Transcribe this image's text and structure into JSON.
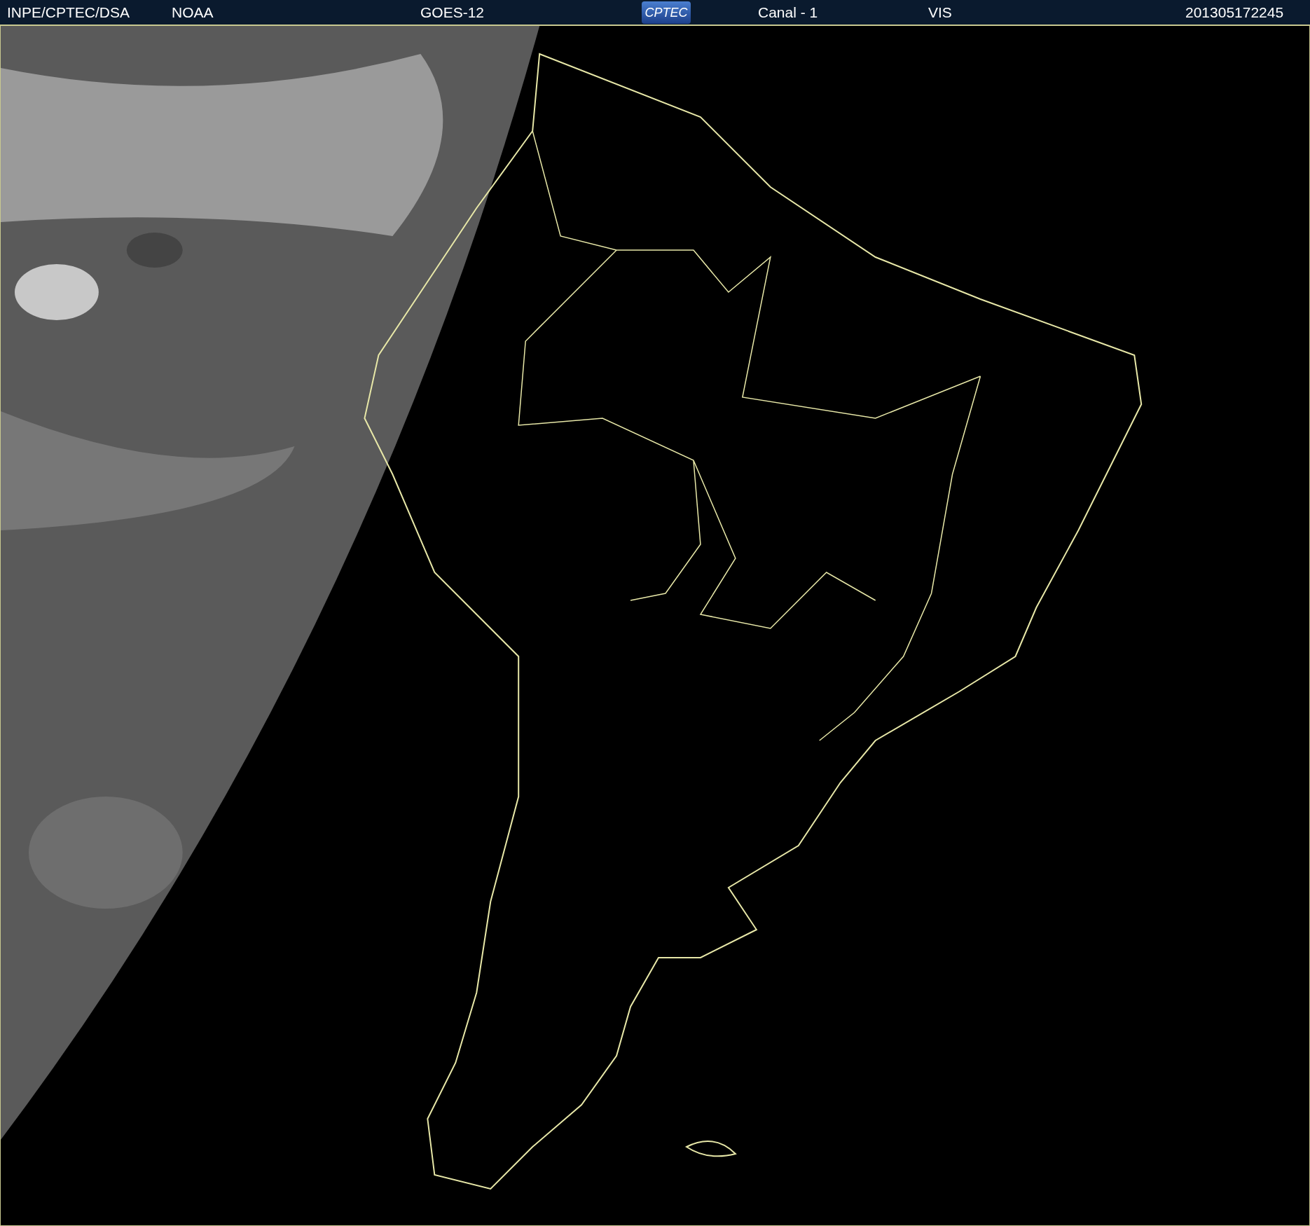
{
  "header": {
    "source": "INPE/CPTEC/DSA",
    "agency": "NOAA",
    "satellite": "GOES-12",
    "logo_text": "CPTEC",
    "channel": "Canal - 1",
    "band": "VIS",
    "timestamp": "201305172245"
  }
}
